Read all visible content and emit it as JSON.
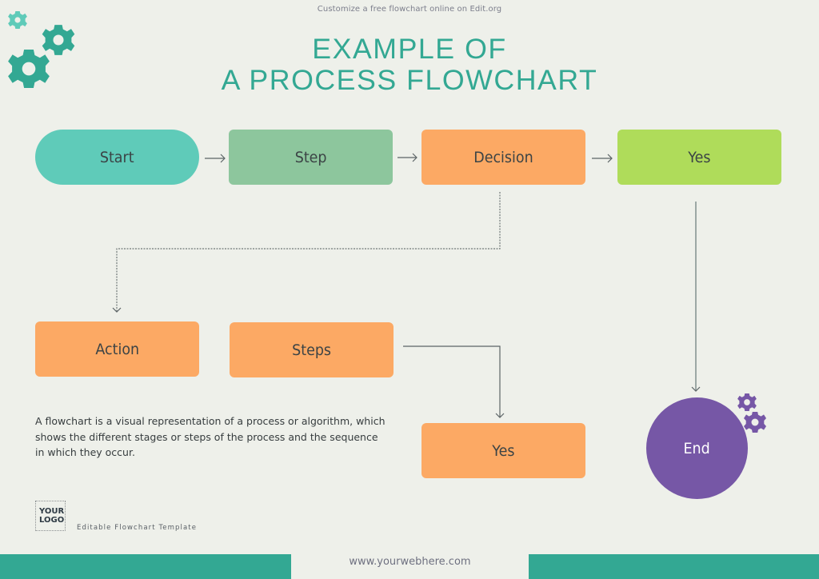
{
  "header": {
    "banner": "Customize a free flowchart online on Edit.org",
    "title_line1": "EXAMPLE OF",
    "title_line2": "A PROCESS FLOWCHART"
  },
  "colors": {
    "title": "#33a893",
    "start": "#5fcbb9",
    "step": "#8dc69d",
    "orange": "#fca964",
    "yes_green": "#afdc5a",
    "end_purple": "#7657a6",
    "footer_teal": "#33a893",
    "background": "#eef0ea"
  },
  "nodes": {
    "start": {
      "label": "Start",
      "shape": "terminator"
    },
    "step": {
      "label": "Step",
      "shape": "process"
    },
    "decision": {
      "label": "Decision",
      "shape": "process"
    },
    "yes_top": {
      "label": "Yes",
      "shape": "process"
    },
    "action": {
      "label": "Action",
      "shape": "process"
    },
    "steps": {
      "label": "Steps",
      "shape": "process"
    },
    "yes_bottom": {
      "label": "Yes",
      "shape": "process"
    },
    "end": {
      "label": "End",
      "shape": "terminator-circle"
    }
  },
  "edges": [
    {
      "from": "start",
      "to": "step",
      "style": "solid"
    },
    {
      "from": "step",
      "to": "decision",
      "style": "solid"
    },
    {
      "from": "decision",
      "to": "yes_top",
      "style": "solid"
    },
    {
      "from": "decision",
      "to": "action",
      "style": "dotted"
    },
    {
      "from": "steps",
      "to": "yes_bottom",
      "style": "solid"
    },
    {
      "from": "yes_top",
      "to": "end",
      "style": "solid"
    }
  ],
  "description": "A flowchart is a visual representation of a process or algorithm, which shows the different stages or steps of the process and the sequence in which they occur.",
  "logo": {
    "line1": "YOUR",
    "line2": "LOGO"
  },
  "tagline": "Editable Flowchart Template",
  "footer": {
    "url": "www.yourwebhere.com"
  },
  "icons": {
    "top_left": [
      "gear-icon",
      "gear-icon",
      "gear-icon"
    ],
    "end_side": [
      "gear-icon",
      "gear-icon"
    ]
  }
}
